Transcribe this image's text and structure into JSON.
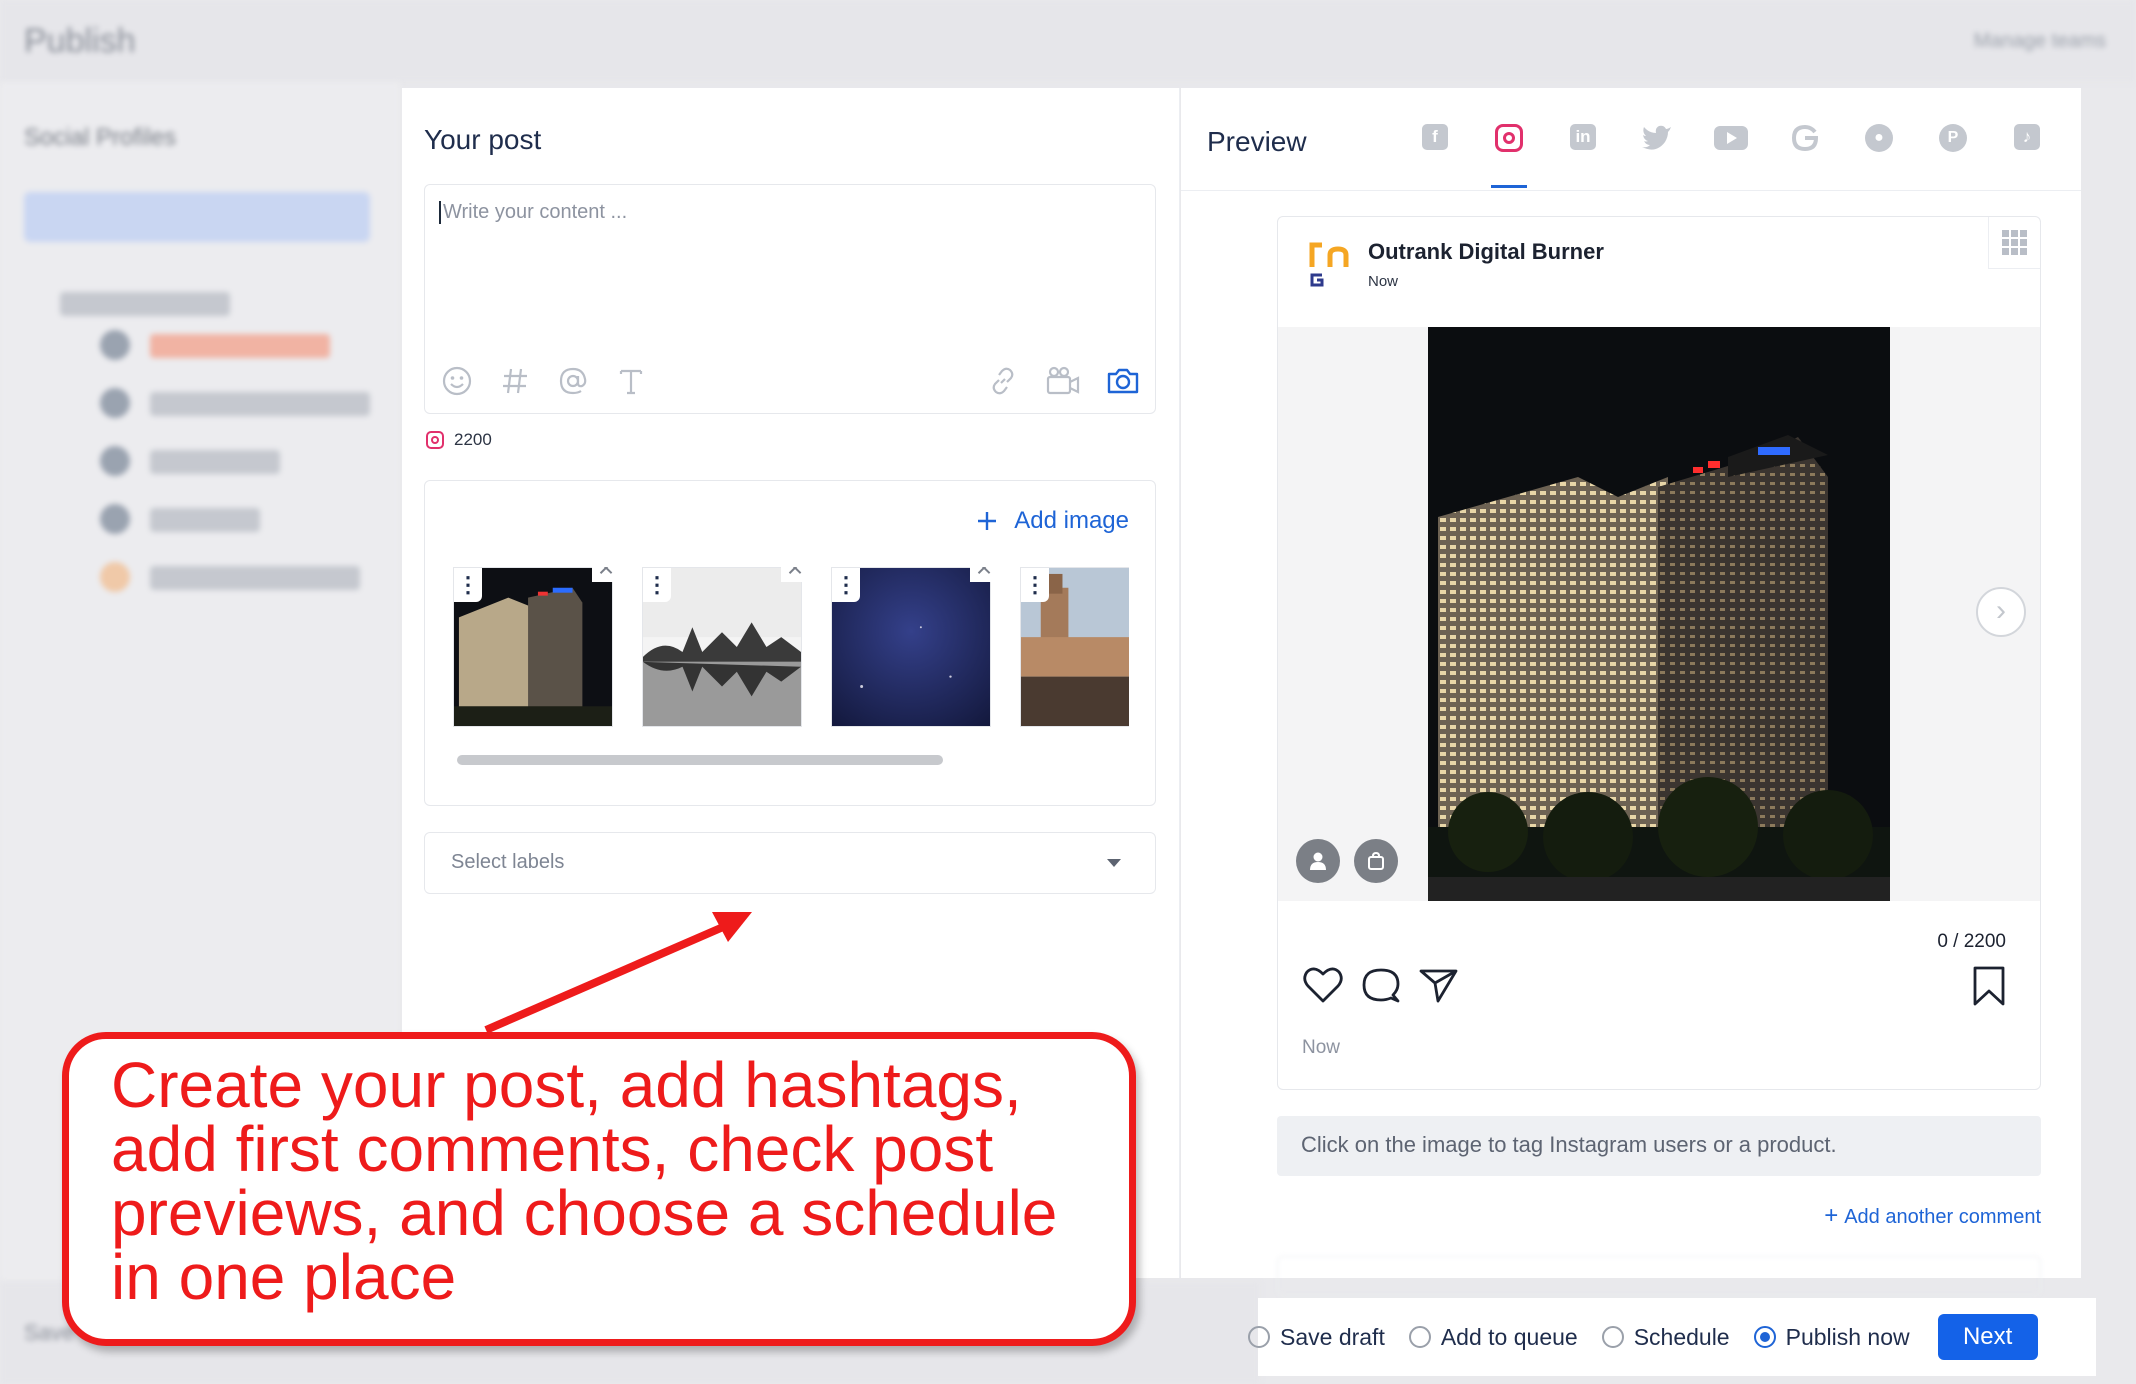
{
  "background": {
    "app_title": "Publish",
    "top_right": "Manage teams",
    "sidebar_heading": "Social Profiles",
    "bottom_left": "Save"
  },
  "post": {
    "title": "Your post",
    "placeholder": "Write your content ...",
    "char_count": "2200",
    "add_image_label": "Add image",
    "labels_placeholder": "Select labels"
  },
  "preview": {
    "title": "Preview",
    "networks": [
      "facebook",
      "instagram",
      "linkedin",
      "twitter",
      "youtube",
      "google",
      "reddit",
      "pinterest",
      "tiktok"
    ],
    "active_network": "instagram",
    "account_name": "Outrank Digital Burner",
    "post_time": "Now",
    "char_counter": "0 / 2200",
    "footer_time": "Now",
    "tag_hint": "Click on the image to tag Instagram users or a product.",
    "add_comment_label": "Add another comment"
  },
  "actions": {
    "save_draft": "Save draft",
    "add_to_queue": "Add to queue",
    "schedule": "Schedule",
    "publish_now": "Publish now",
    "selected": "publish_now",
    "next_label": "Next"
  },
  "annotation": {
    "text": "Create your post, add hashtags, add first comments, check post previews, and choose a schedule in one place"
  },
  "colors": {
    "accent": "#1e64d6",
    "instagram": "#e1306c",
    "callout": "#ee1b1b"
  }
}
